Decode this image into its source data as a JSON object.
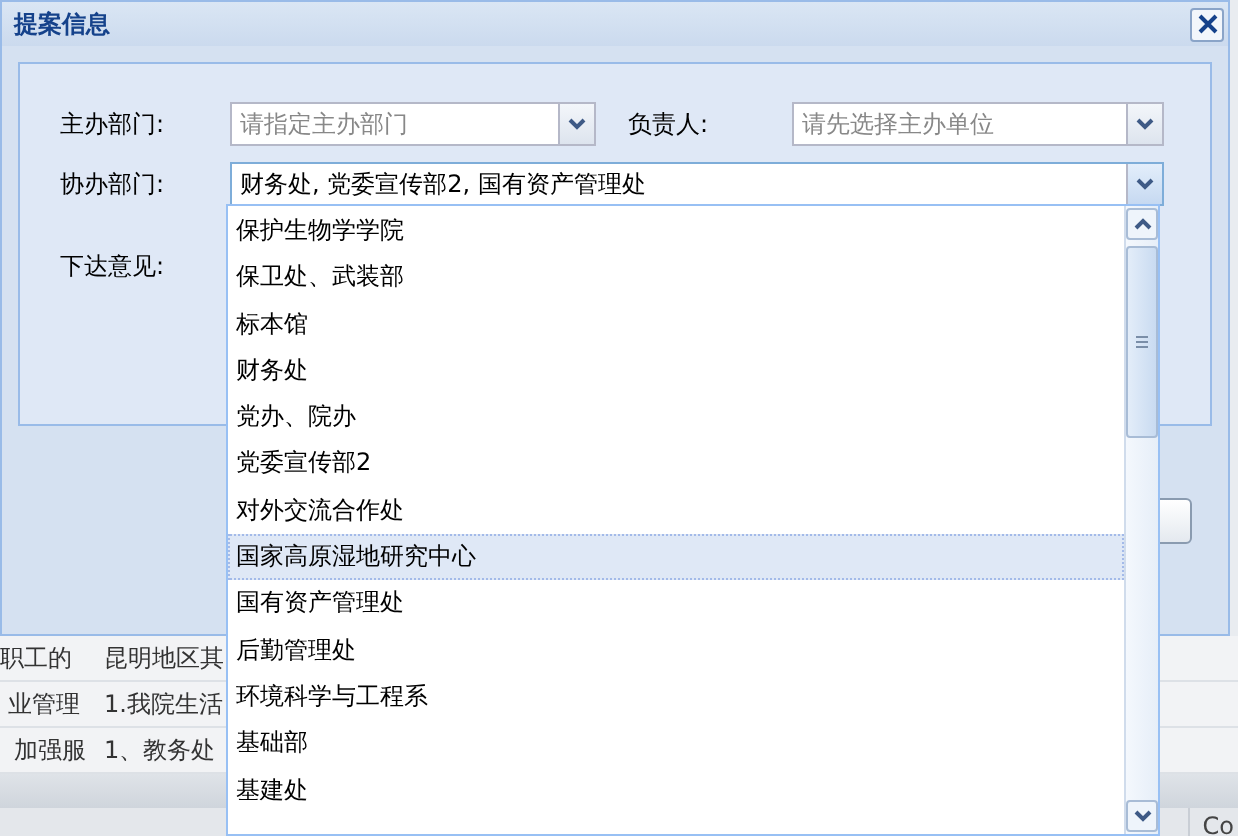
{
  "dialog": {
    "title": "提案信息",
    "fields": [
      {
        "label": "主办部门:",
        "placeholder": "请指定主办部门"
      },
      {
        "label": "负责人:",
        "placeholder": "请先选择主办单位"
      }
    ],
    "assist": {
      "label": "协办部门:",
      "value": "财务处, 党委宣传部2, 国有资产管理处",
      "expanded": true
    },
    "opinion": {
      "label": "下达意见:"
    }
  },
  "dropdown": {
    "options": [
      {
        "label": "保护生物学学院",
        "selected": false
      },
      {
        "label": "保卫处、武装部",
        "selected": false
      },
      {
        "label": "标本馆",
        "selected": false
      },
      {
        "label": "财务处",
        "selected": false
      },
      {
        "label": "党办、院办",
        "selected": false
      },
      {
        "label": "党委宣传部2",
        "selected": false
      },
      {
        "label": "对外交流合作处",
        "selected": false
      },
      {
        "label": "国家高原湿地研究中心",
        "selected": true
      },
      {
        "label": "国有资产管理处",
        "selected": false
      },
      {
        "label": "后勤管理处",
        "selected": false
      },
      {
        "label": "环境科学与工程系",
        "selected": false
      },
      {
        "label": "基础部",
        "selected": false
      },
      {
        "label": "基建处",
        "selected": false
      }
    ]
  },
  "background": {
    "rows": [
      [
        "职工的",
        "昆明地区其"
      ],
      [
        "业管理",
        "1.我院生活"
      ],
      [
        "加强服",
        "1、教务处"
      ]
    ],
    "footer": "Co"
  }
}
